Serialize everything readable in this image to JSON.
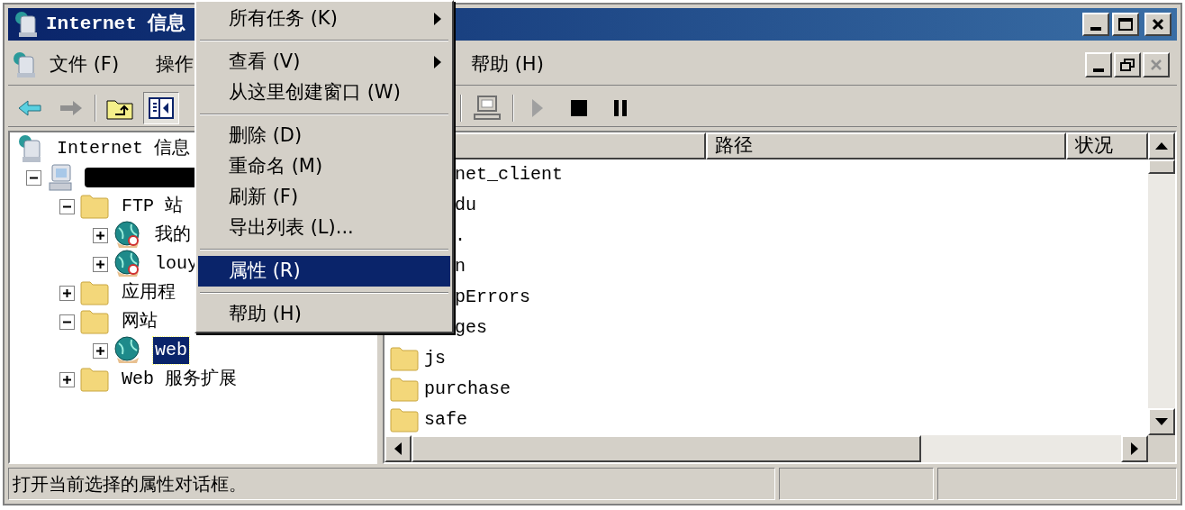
{
  "window": {
    "title": "Internet 信息"
  },
  "menu_bar": [
    {
      "label": "文件 (F)"
    },
    {
      "label": "操作"
    },
    {
      "label": "帮助 (H)"
    }
  ],
  "tree": [
    {
      "label": "Internet 信息",
      "kind": "iis",
      "children": [
        {
          "redacted": true,
          "kind": "server",
          "expanded": true,
          "children": [
            {
              "label": "FTP 站",
              "kind": "folder",
              "expanded": true,
              "children": [
                {
                  "label": "我的",
                  "kind": "ftp",
                  "expanded": false,
                  "selected": false
                },
                {
                  "label": "louy",
                  "kind": "ftp",
                  "expanded": false,
                  "selected": false
                }
              ]
            },
            {
              "label": "应用程",
              "kind": "folder",
              "expanded": false
            },
            {
              "label": "网站",
              "kind": "folder",
              "expanded": true,
              "children": [
                {
                  "label": "web",
                  "kind": "web",
                  "expanded": false,
                  "selected": true
                }
              ]
            },
            {
              "label": "Web 服务扩展",
              "kind": "folder",
              "expanded": false
            }
          ]
        }
      ]
    }
  ],
  "list": {
    "columns": [
      "路径",
      "状况"
    ],
    "rows": [
      {
        "name": "net_client",
        "icon": false
      },
      {
        "name": "du",
        "icon": false
      },
      {
        "name": ".",
        "icon": false
      },
      {
        "name": "n",
        "icon": false
      },
      {
        "name": "pErrors",
        "icon": false
      },
      {
        "name": "ges",
        "icon": false
      },
      {
        "name": "js",
        "icon": true
      },
      {
        "name": "purchase",
        "icon": true
      },
      {
        "name": "safe",
        "icon": true
      }
    ]
  },
  "context_menu": [
    {
      "kind": "item",
      "label": "所有任务 (K)",
      "submenu": true,
      "selected": false
    },
    {
      "kind": "separator"
    },
    {
      "kind": "item",
      "label": "查看 (V)",
      "submenu": true,
      "selected": false
    },
    {
      "kind": "item",
      "label": "从这里创建窗口 (W)",
      "submenu": false,
      "selected": false
    },
    {
      "kind": "separator"
    },
    {
      "kind": "item",
      "label": "删除 (D)",
      "submenu": false,
      "selected": false
    },
    {
      "kind": "item",
      "label": "重命名 (M)",
      "submenu": false,
      "selected": false
    },
    {
      "kind": "item",
      "label": "刷新 (F)",
      "submenu": false,
      "selected": false
    },
    {
      "kind": "item",
      "label": "导出列表 (L)...",
      "submenu": false,
      "selected": false
    },
    {
      "kind": "separator"
    },
    {
      "kind": "item",
      "label": "属性 (R)",
      "submenu": false,
      "selected": true
    },
    {
      "kind": "separator"
    },
    {
      "kind": "item",
      "label": "帮助 (H)",
      "submenu": false,
      "selected": false
    }
  ],
  "status_bar": {
    "text": "打开当前选择的属性对话框。"
  }
}
